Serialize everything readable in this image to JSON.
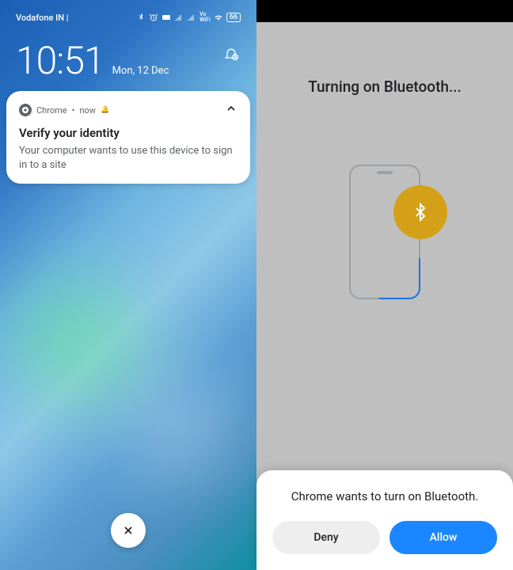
{
  "left": {
    "status": {
      "carrier": "Vodafone IN |",
      "battery": "66",
      "volte": "Vo\nWiFi"
    },
    "clock": {
      "time": "10:51",
      "date": "Mon, 12 Dec"
    },
    "notification": {
      "app": "Chrome",
      "time": "now",
      "separator": "•",
      "title": "Verify your identity",
      "body": "Your computer wants to use this device to sign in to a site"
    }
  },
  "right": {
    "title": "Turning on Bluetooth...",
    "sheet": {
      "message": "Chrome wants to turn on Bluetooth.",
      "deny": "Deny",
      "allow": "Allow"
    }
  }
}
